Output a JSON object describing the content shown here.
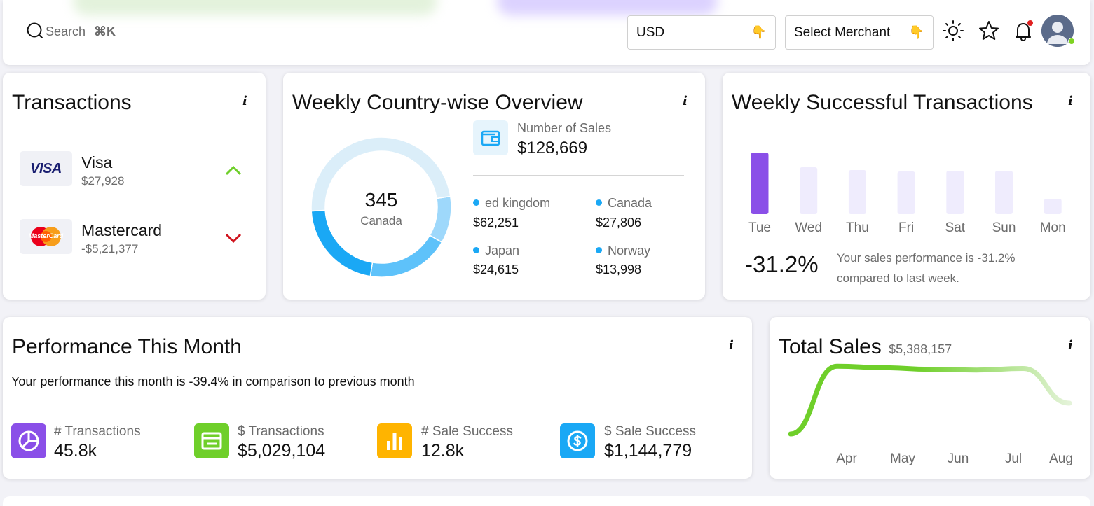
{
  "header": {
    "search_placeholder": "Search",
    "search_shortcut": "⌘K",
    "currency": "USD",
    "merchant_select": "Select Merchant",
    "icons": [
      "search-icon",
      "pointing-hand-icon",
      "sun-icon",
      "star-icon",
      "bell-icon",
      "avatar"
    ],
    "notification_dot_color": "#e02020"
  },
  "transactions": {
    "title": "Transactions",
    "info": "i",
    "items": [
      {
        "brand_logo": "VISA",
        "name": "Visa",
        "amount": "$27,928",
        "trend": "up"
      },
      {
        "brand_logo": "MasterCard",
        "name": "Mastercard",
        "amount": "-$5,21,377",
        "trend": "down"
      }
    ]
  },
  "country_overview": {
    "title": "Weekly Country-wise Overview",
    "info": "i",
    "center_value": "345",
    "center_label": "Canada",
    "sales_label": "Number of Sales",
    "sales_value": "$128,669",
    "countries": [
      {
        "name": "ed kingdom",
        "value": "$62,251"
      },
      {
        "name": "Canada",
        "value": "$27,806"
      },
      {
        "name": "Japan",
        "value": "$24,615"
      },
      {
        "name": "Norway",
        "value": "$13,998"
      }
    ]
  },
  "weekly_success": {
    "title": "Weekly Successful Transactions",
    "info": "i",
    "percent": "-31.2%",
    "note_line1": "Your sales performance is -31.2%",
    "note_line2": "compared to last week."
  },
  "performance": {
    "title": "Performance This Month",
    "info": "i",
    "summary": "Your performance this month is -39.4% in comparison to previous month",
    "stats": [
      {
        "label": "# Transactions",
        "value": "45.8k",
        "icon": "pie-chart-icon",
        "color": "#8a4fe8"
      },
      {
        "label": "$ Transactions",
        "value": "$5,029,104",
        "icon": "wallet-icon",
        "color": "#6fcf2a"
      },
      {
        "label": "# Sale Success",
        "value": "12.8k",
        "icon": "bar-chart-icon",
        "color": "#ffb400"
      },
      {
        "label": "$ Sale Success",
        "value": "$1,144,779",
        "icon": "dollar-coin-icon",
        "color": "#1aa8f5"
      }
    ]
  },
  "total_sales": {
    "title": "Total Sales",
    "amount": "$5,388,157",
    "info": "i"
  },
  "chart_data": [
    {
      "type": "pie",
      "categories": [
        "ed kingdom",
        "Canada",
        "Japan",
        "Norway"
      ],
      "values": [
        62251,
        27806,
        24615,
        13998
      ],
      "colors": [
        "#dbeef9",
        "#1aa8f5",
        "#5ec2fa",
        "#9ed8fb"
      ],
      "title": "Weekly Country-wise Overview"
    },
    {
      "type": "bar",
      "categories": [
        "Tue",
        "Wed",
        "Thu",
        "Fri",
        "Sat",
        "Sun",
        "Mon"
      ],
      "values": [
        88,
        67,
        63,
        61,
        62,
        62,
        22
      ],
      "highlight_index": 0,
      "highlight_color": "#8a4fe8",
      "bar_color": "#efecfd",
      "ylim": [
        0,
        100
      ],
      "title": "Weekly Successful Transactions"
    },
    {
      "type": "line",
      "categories": [
        "Apr",
        "May",
        "Jun",
        "Jul",
        "Aug"
      ],
      "x": [
        0,
        1,
        2,
        3,
        4,
        5,
        6
      ],
      "values": [
        10,
        98,
        96,
        94,
        93,
        95,
        50
      ],
      "ylim": [
        0,
        100
      ],
      "line_color_start": "#6fcf2a",
      "line_color_end": "#e4f3d9",
      "title": "Total Sales"
    }
  ]
}
